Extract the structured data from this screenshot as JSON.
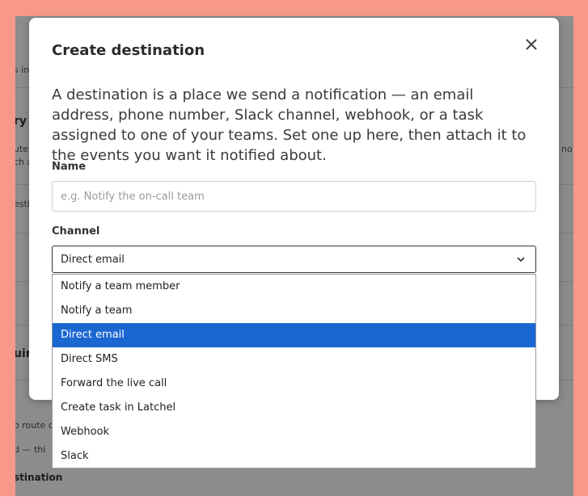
{
  "background": {
    "fragments": {
      "s_in": "s in",
      "ry": "ry",
      "ute": "ute",
      "ch_a": "ch a",
      "no": "no",
      "esti": "esti",
      "uir": "uir",
      "route": "o route c",
      "d_thi": "d — thi",
      "stination": "stination"
    }
  },
  "modal": {
    "title": "Create destination",
    "close_label": "×",
    "description": "A destination is a place we send a notification — an email address, phone number, Slack channel, webhook, or a task assigned to one of your teams. Set one up here, then attach it to the events you want it notified about.",
    "name": {
      "label": "Name",
      "placeholder": "e.g. Notify the on-call team",
      "value": ""
    },
    "channel": {
      "label": "Channel",
      "selected": "Direct email",
      "options": [
        "Notify a team member",
        "Notify a team",
        "Direct email",
        "Direct SMS",
        "Forward the live call",
        "Create task in Latchel",
        "Webhook",
        "Slack"
      ]
    }
  },
  "colors": {
    "page_background": "#f7988a",
    "selected_option": "#1a67d2"
  }
}
